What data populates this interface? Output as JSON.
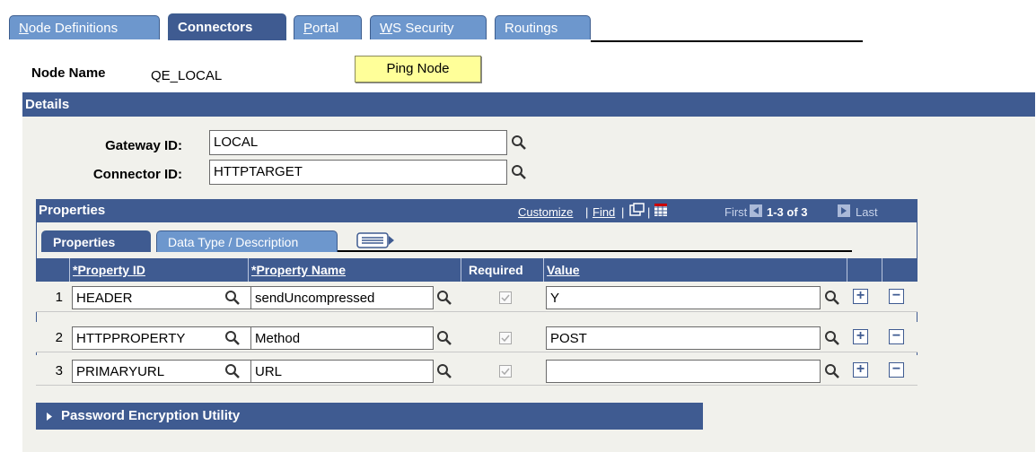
{
  "tabs": [
    {
      "label": "Node Definitions",
      "accel": "N"
    },
    {
      "label": "Connectors",
      "active": true
    },
    {
      "label": "Portal",
      "accel": "P"
    },
    {
      "label": "WS Security",
      "accel": "W"
    },
    {
      "label": "Routings"
    }
  ],
  "header": {
    "node_name_label": "Node Name",
    "node_name_value": "QE_LOCAL",
    "ping_button": "Ping Node"
  },
  "details": {
    "title": "Details",
    "gateway_label": "Gateway ID:",
    "gateway_value": "LOCAL",
    "connector_label": "Connector ID:",
    "connector_value": "HTTPTARGET"
  },
  "properties_grid": {
    "title": "Properties",
    "customize": "Customize",
    "find": "Find",
    "first": "First",
    "range": "1-3 of 3",
    "last": "Last",
    "subtabs": [
      "Properties",
      "Data Type / Description"
    ],
    "columns": [
      "*Property ID",
      "*Property Name",
      "Required",
      "Value"
    ],
    "rows": [
      {
        "num": "1",
        "property_id": "HEADER",
        "property_name": "sendUncompressed",
        "required": true,
        "value": "Y"
      },
      {
        "num": "2",
        "property_id": "HTTPPROPERTY",
        "property_name": "Method",
        "required": true,
        "value": "POST"
      },
      {
        "num": "3",
        "property_id": "PRIMARYURL",
        "property_name": "URL",
        "required": true,
        "value": ""
      }
    ]
  },
  "password_section": {
    "title": "Password Encryption Utility"
  },
  "colors": {
    "header_blue": "#3f5b91",
    "tab_light_blue": "#6d97cd",
    "panel_grey": "#f1f1ec",
    "ping_yellow": "#ffff99"
  },
  "icons": [
    "search-icon",
    "plus-icon",
    "minus-icon",
    "zoom-icon",
    "grid-download-icon",
    "arrow-left-icon",
    "arrow-right-icon",
    "expand-all-icon",
    "triangle-right-icon"
  ]
}
